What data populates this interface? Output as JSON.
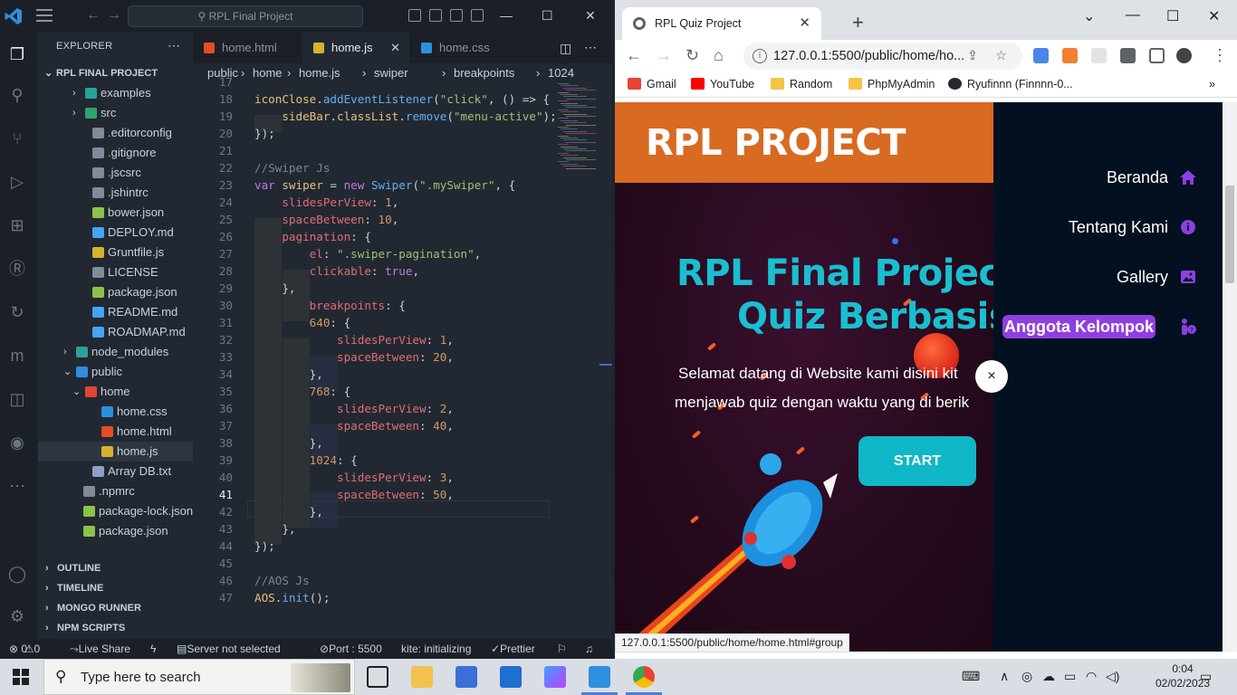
{
  "vscode": {
    "search_placeholder": "RPL Final Project",
    "explorer_title": "EXPLORER",
    "project_title": "RPL FINAL PROJECT",
    "tree": [
      {
        "label": "examples",
        "kind": "folder",
        "depth": 1,
        "open": false
      },
      {
        "label": "src",
        "kind": "folder",
        "depth": 1,
        "open": false
      },
      {
        "label": ".editorconfig",
        "kind": "file",
        "depth": 1
      },
      {
        "label": ".gitignore",
        "kind": "file",
        "depth": 1
      },
      {
        "label": ".jscsrc",
        "kind": "file",
        "depth": 1
      },
      {
        "label": ".jshintrc",
        "kind": "file",
        "depth": 1
      },
      {
        "label": "bower.json",
        "kind": "file",
        "depth": 1
      },
      {
        "label": "DEPLOY.md",
        "kind": "file",
        "depth": 1
      },
      {
        "label": "Gruntfile.js",
        "kind": "file",
        "depth": 1
      },
      {
        "label": "LICENSE",
        "kind": "file",
        "depth": 1
      },
      {
        "label": "package.json",
        "kind": "file",
        "depth": 1
      },
      {
        "label": "README.md",
        "kind": "file",
        "depth": 1
      },
      {
        "label": "ROADMAP.md",
        "kind": "file",
        "depth": 1
      },
      {
        "label": "node_modules",
        "kind": "folder",
        "depth": 0,
        "open": false
      },
      {
        "label": "public",
        "kind": "folder",
        "depth": 0,
        "open": true
      },
      {
        "label": "home",
        "kind": "folder",
        "depth": 1,
        "open": true
      },
      {
        "label": "home.css",
        "kind": "file",
        "depth": 2
      },
      {
        "label": "home.html",
        "kind": "file",
        "depth": 2
      },
      {
        "label": "home.js",
        "kind": "file",
        "depth": 2,
        "selected": true
      },
      {
        "label": "Array DB.txt",
        "kind": "file",
        "depth": 1
      },
      {
        "label": ".npmrc",
        "kind": "file",
        "depth": 0
      },
      {
        "label": "package-lock.json",
        "kind": "file",
        "depth": 0
      },
      {
        "label": "package.json",
        "kind": "file",
        "depth": 0
      }
    ],
    "sections": [
      "OUTLINE",
      "TIMELINE",
      "MONGO RUNNER",
      "NPM SCRIPTS"
    ],
    "tabs": [
      {
        "label": "home.html",
        "active": false
      },
      {
        "label": "home.js",
        "active": true
      },
      {
        "label": "home.css",
        "active": false
      }
    ],
    "breadcrumbs": [
      "public",
      "home",
      "home.js",
      "swiper",
      "breakpoints",
      "1024"
    ],
    "current_line": 41,
    "code_lines": [
      {
        "n": 17,
        "text": ""
      },
      {
        "n": 18,
        "text": "iconClose.addEventListener(\"click\", () => {"
      },
      {
        "n": 19,
        "text": "    sideBar.classList.remove(\"menu-active\");"
      },
      {
        "n": 20,
        "text": "});"
      },
      {
        "n": 21,
        "text": ""
      },
      {
        "n": 22,
        "text": "//Swiper Js"
      },
      {
        "n": 23,
        "text": "var swiper = new Swiper(\".mySwiper\", {"
      },
      {
        "n": 24,
        "text": "    slidesPerView: 1,"
      },
      {
        "n": 25,
        "text": "    spaceBetween: 10,"
      },
      {
        "n": 26,
        "text": "    pagination: {"
      },
      {
        "n": 27,
        "text": "        el: \".swiper-pagination\","
      },
      {
        "n": 28,
        "text": "        clickable: true,"
      },
      {
        "n": 29,
        "text": "    },"
      },
      {
        "n": 30,
        "text": "        breakpoints: {"
      },
      {
        "n": 31,
        "text": "        640: {"
      },
      {
        "n": 32,
        "text": "            slidesPerView: 1,"
      },
      {
        "n": 33,
        "text": "            spaceBetween: 20,"
      },
      {
        "n": 34,
        "text": "        },"
      },
      {
        "n": 35,
        "text": "        768: {"
      },
      {
        "n": 36,
        "text": "            slidesPerView: 2,"
      },
      {
        "n": 37,
        "text": "            spaceBetween: 40,"
      },
      {
        "n": 38,
        "text": "        },"
      },
      {
        "n": 39,
        "text": "        1024: {"
      },
      {
        "n": 40,
        "text": "            slidesPerView: 3,"
      },
      {
        "n": 41,
        "text": "            spaceBetween: 50,"
      },
      {
        "n": 42,
        "text": "        },"
      },
      {
        "n": 43,
        "text": "    },"
      },
      {
        "n": 44,
        "text": "});"
      },
      {
        "n": 45,
        "text": ""
      },
      {
        "n": 46,
        "text": "//AOS Js"
      },
      {
        "n": 47,
        "text": "AOS.init();"
      }
    ],
    "status": {
      "errors": "0",
      "warnings": "0",
      "live_share": "Live Share",
      "server": "Server not selected",
      "port": "Port : 5500",
      "kite": "kite: initializing",
      "prettier": "Prettier"
    }
  },
  "browser": {
    "tab_title": "RPL Quiz Project",
    "url": "127.0.0.1:5500/public/home/ho...",
    "bookmarks": [
      "Gmail",
      "YouTube",
      "Random",
      "PhpMyAdmin",
      "Ryufinnn (Finnnn-0..."
    ],
    "status_url": "127.0.0.1:5500/public/home/home.html#group",
    "page": {
      "brand": "RPL PROJECT",
      "title_line1": "RPL Final Project",
      "title_line2": "Quiz Berbasis",
      "desc_line1": "Selamat datang di Website kami disini kit",
      "desc_line2": "menjawab quiz dengan waktu yang di berik",
      "start": "START",
      "nav": [
        "Beranda",
        "Tentang Kami",
        "Gallery",
        "Anggota Kelompok"
      ],
      "close": "×"
    }
  },
  "taskbar": {
    "search_placeholder": "Type here to search",
    "time": "0:04",
    "date": "02/02/2023"
  }
}
